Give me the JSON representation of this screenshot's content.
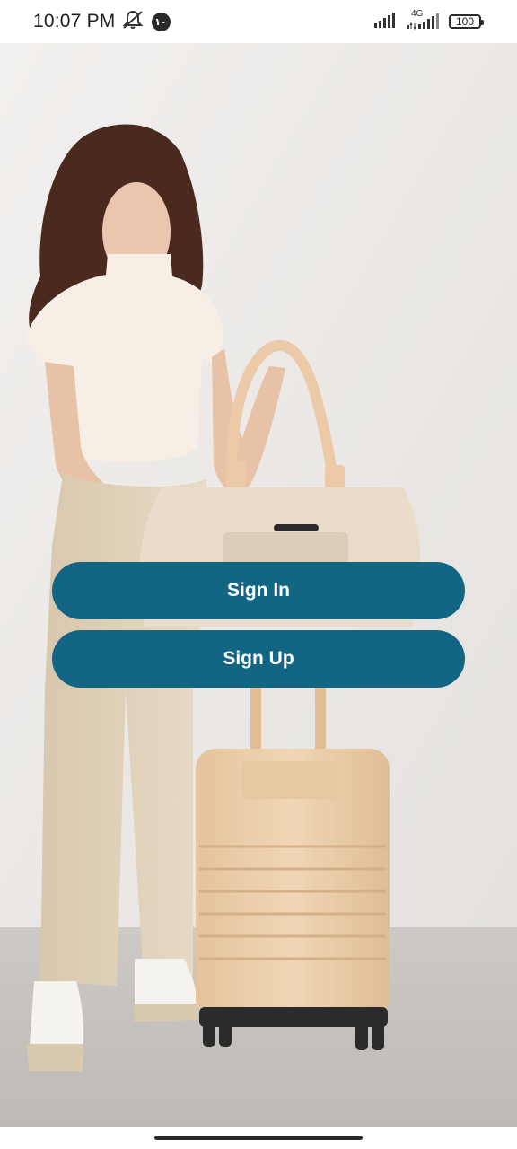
{
  "status_bar": {
    "time": "10:07 PM",
    "notification_badge": "١٠",
    "network_type": "4G",
    "battery_level": "100",
    "icons": [
      "mute-icon",
      "cell-signal-icon",
      "battery-icon"
    ]
  },
  "hero": {
    "image": "woman-with-luggage-illustration"
  },
  "auth": {
    "sign_in_label": "Sign In",
    "sign_up_label": "Sign Up"
  },
  "colors": {
    "primary_button": "#126684",
    "button_text": "#ffffff",
    "wall": "#ece9e6",
    "floor": "#c9c6c2",
    "luggage": "#ecd0ad"
  }
}
